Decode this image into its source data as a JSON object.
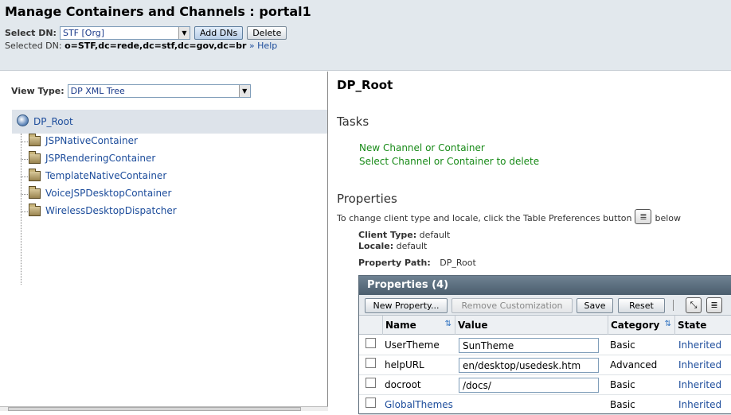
{
  "header": {
    "title": "Manage Containers and Channels : portal1",
    "select_dn_label": "Select DN:",
    "select_dn_value": "STF [Org]",
    "add_dns_label": "Add DNs",
    "delete_label": "Delete",
    "selected_dn_prefix": "Selected DN:",
    "selected_dn_value": "o=STF,dc=rede,dc=stf,dc=gov,dc=br",
    "help_link": "» Help"
  },
  "left": {
    "view_type_label": "View Type:",
    "view_type_value": "DP XML Tree",
    "root_node": "DP_Root",
    "children": [
      "JSPNativeContainer",
      "JSPRenderingContainer",
      "TemplateNativeContainer",
      "VoiceJSPDesktopContainer",
      "WirelessDesktopDispatcher"
    ]
  },
  "right": {
    "title": "DP_Root",
    "tasks_heading": "Tasks",
    "task_links": [
      "New Channel or Container",
      "Select Channel or Container to delete"
    ],
    "properties_heading": "Properties",
    "description_before": "To change client type and locale, click the Table Preferences button",
    "description_after": "below",
    "client_type_label": "Client Type:",
    "client_type_value": "default",
    "locale_label": "Locale:",
    "locale_value": "default",
    "property_path_label": "Property Path:",
    "property_path_value": "DP_Root"
  },
  "table": {
    "title": "Properties (4)",
    "buttons": {
      "new_property": "New Property...",
      "remove_customization": "Remove Customization",
      "save": "Save",
      "reset": "Reset"
    },
    "columns": [
      "Name",
      "Value",
      "Category",
      "State"
    ],
    "rows": [
      {
        "name": "UserTheme",
        "value": "SunTheme",
        "category": "Basic",
        "state": "Inherited"
      },
      {
        "name": "helpURL",
        "value": "en/desktop/usedesk.htm",
        "category": "Advanced",
        "state": "Inherited"
      },
      {
        "name": "docroot",
        "value": "/docs/",
        "category": "Basic",
        "state": "Inherited"
      },
      {
        "name": "GlobalThemes",
        "value": "",
        "category": "Basic",
        "state": "Inherited"
      }
    ]
  }
}
